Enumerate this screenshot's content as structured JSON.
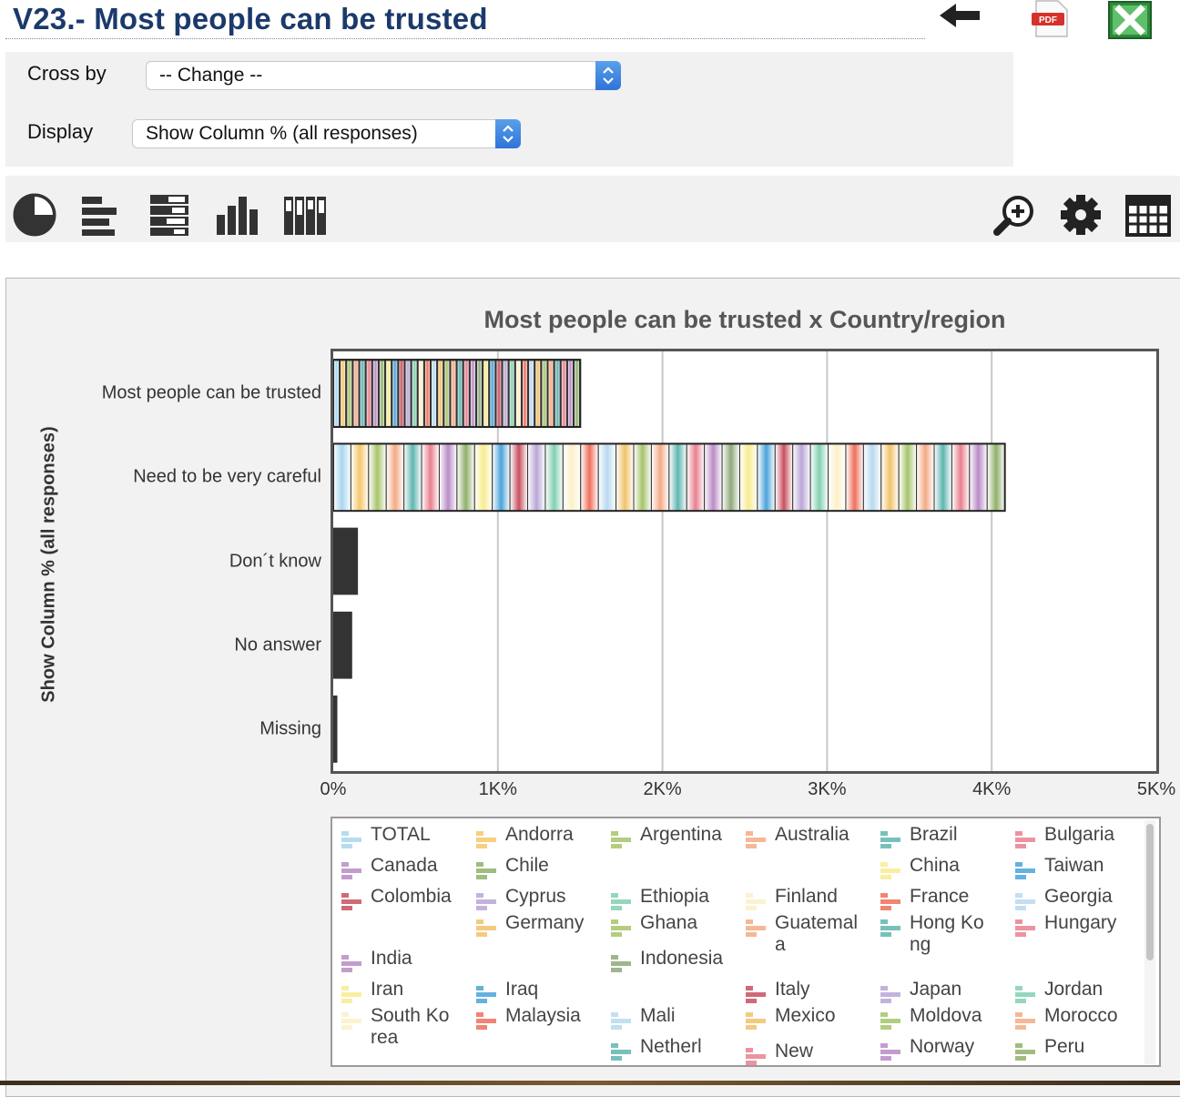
{
  "header": {
    "title": "V23.- Most people can be trusted",
    "pdf_label": "PDF",
    "icons": [
      "back-arrow-icon",
      "pdf-icon",
      "excel-icon"
    ]
  },
  "controls": {
    "cross_by_label": "Cross by",
    "cross_by_value": "-- Change --",
    "display_label": "Display",
    "display_value": "Show Column % (all responses)"
  },
  "toolbar": {
    "left_icons": [
      "pie-chart-icon",
      "horizontal-bar-icon",
      "stacked-horizontal-bar-icon",
      "vertical-bar-icon",
      "stacked-vertical-bar-icon"
    ],
    "right_icons": [
      "zoom-in-icon",
      "gear-icon",
      "table-icon"
    ]
  },
  "chart_data": {
    "type": "bar",
    "orientation": "horizontal",
    "stacked": true,
    "title": "Most people can be trusted x Country/region",
    "ylabel": "Show Column % (all responses)",
    "xlabel": "",
    "categories": [
      "Most people can be trusted",
      "Need to be very careful",
      "Don´t know",
      "No answer",
      "Missing"
    ],
    "totals": [
      1500,
      4080,
      150,
      115,
      25
    ],
    "xlim": [
      0,
      5000
    ],
    "x_ticks": [
      "0%",
      "1K%",
      "2K%",
      "3K%",
      "4K%",
      "5K%"
    ],
    "grid": true,
    "legend": {
      "placement": "bottom",
      "entries": [
        "TOTAL",
        "Andorra",
        "Argentina",
        "Australia",
        "Brazil",
        "Bulgaria",
        "Canada",
        "Chile",
        "China",
        "Taiwan",
        "Colombia",
        "Cyprus",
        "Ethiopia",
        "Finland",
        "France",
        "Georgia",
        "Germany",
        "Ghana",
        "Guatemala",
        "Hong Kong",
        "Hungary",
        "India",
        "Indonesia",
        "Iran",
        "Iraq",
        "Italy",
        "Japan",
        "Jordan",
        "South Korea",
        "Malaysia",
        "Mali",
        "Mexico",
        "Moldova",
        "Morocco",
        "Netherl",
        "New",
        "Norway",
        "Peru"
      ],
      "colors": [
        "#a9d6f0",
        "#f5c76a",
        "#a6c46a",
        "#f4aa85",
        "#5fb5b0",
        "#e8808e",
        "#b98bc6",
        "#8fb06a",
        "#f7ec8f",
        "#4aa3d9",
        "#c7505f",
        "#b9a6d6",
        "#83d0b0",
        "#fbf0c8",
        "#ef6f5a",
        "#b8d9ef",
        "#f1c26a",
        "#a6c46a",
        "#f4aa85",
        "#5fb5b0",
        "#e8808e",
        "#b98bc6",
        "#8fa87a",
        "#f7ec8f",
        "#4aa3d9",
        "#c7505f",
        "#b9a6d6",
        "#83d0b0",
        "#fbf0c8",
        "#ef6f5a",
        "#b8d9ef",
        "#f1c26a",
        "#a6c46a",
        "#f4aa85",
        "#5fb5b0",
        "#e8808e",
        "#b98bc6",
        "#8fb06a"
      ]
    }
  }
}
